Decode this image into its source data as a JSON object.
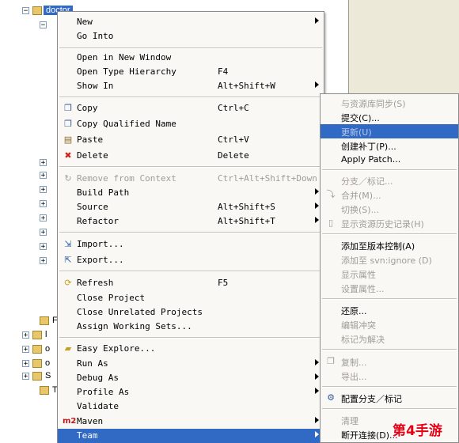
{
  "tree": {
    "project_label": "doctor",
    "side_letters": [
      "F",
      "l",
      "o",
      "o",
      "S",
      "T"
    ]
  },
  "menu": {
    "items": [
      {
        "label": "New",
        "shortcut": "",
        "submenu": true
      },
      {
        "label": "Go Into",
        "shortcut": "",
        "submenu": false
      },
      {
        "label": "Open in New Window",
        "shortcut": "",
        "submenu": false
      },
      {
        "label": "Open Type Hierarchy",
        "shortcut": "F4",
        "submenu": false
      },
      {
        "label": "Show In",
        "shortcut": "Alt+Shift+W",
        "submenu": true
      },
      {
        "label": "Copy",
        "shortcut": "Ctrl+C",
        "submenu": false
      },
      {
        "label": "Copy Qualified Name",
        "shortcut": "",
        "submenu": false
      },
      {
        "label": "Paste",
        "shortcut": "Ctrl+V",
        "submenu": false
      },
      {
        "label": "Delete",
        "shortcut": "Delete",
        "submenu": false
      },
      {
        "label": "Remove from Context",
        "shortcut": "Ctrl+Alt+Shift+Down",
        "submenu": false
      },
      {
        "label": "Build Path",
        "shortcut": "",
        "submenu": true
      },
      {
        "label": "Source",
        "shortcut": "Alt+Shift+S",
        "submenu": true
      },
      {
        "label": "Refactor",
        "shortcut": "Alt+Shift+T",
        "submenu": true
      },
      {
        "label": "Import...",
        "shortcut": "",
        "submenu": false
      },
      {
        "label": "Export...",
        "shortcut": "",
        "submenu": false
      },
      {
        "label": "Refresh",
        "shortcut": "F5",
        "submenu": false
      },
      {
        "label": "Close Project",
        "shortcut": "",
        "submenu": false
      },
      {
        "label": "Close Unrelated Projects",
        "shortcut": "",
        "submenu": false
      },
      {
        "label": "Assign Working Sets...",
        "shortcut": "",
        "submenu": false
      },
      {
        "label": "Easy Explore...",
        "shortcut": "",
        "submenu": false
      },
      {
        "label": "Run As",
        "shortcut": "",
        "submenu": true
      },
      {
        "label": "Debug As",
        "shortcut": "",
        "submenu": true
      },
      {
        "label": "Profile As",
        "shortcut": "",
        "submenu": true
      },
      {
        "label": "Validate",
        "shortcut": "",
        "submenu": false
      },
      {
        "label": "Maven",
        "shortcut": "",
        "submenu": true
      },
      {
        "label": "Team",
        "shortcut": "",
        "submenu": true
      }
    ]
  },
  "team_submenu": {
    "items": [
      {
        "label": "与资源库同步(S)"
      },
      {
        "label": "提交(C)..."
      },
      {
        "label": "更新(U)"
      },
      {
        "label": "创建补丁(P)..."
      },
      {
        "label": "Apply Patch..."
      },
      {
        "label": "分支／标记..."
      },
      {
        "label": "合并(M)..."
      },
      {
        "label": "切换(S)..."
      },
      {
        "label": "显示资源历史记录(H)"
      },
      {
        "label": "添加至版本控制(A)"
      },
      {
        "label": "添加至 svn:ignore (D)"
      },
      {
        "label": "显示属性"
      },
      {
        "label": "设置属性..."
      },
      {
        "label": "还原..."
      },
      {
        "label": "编辑冲突"
      },
      {
        "label": "标记为解决"
      },
      {
        "label": "复制..."
      },
      {
        "label": "导出..."
      },
      {
        "label": "配置分支／标记"
      },
      {
        "label": "清理"
      },
      {
        "label": "断开连接(D)..."
      }
    ]
  },
  "watermark": "第4手游",
  "colors": {
    "highlight": "#316ac5",
    "disabled": "#a09d96",
    "watermark": "#e60012"
  }
}
